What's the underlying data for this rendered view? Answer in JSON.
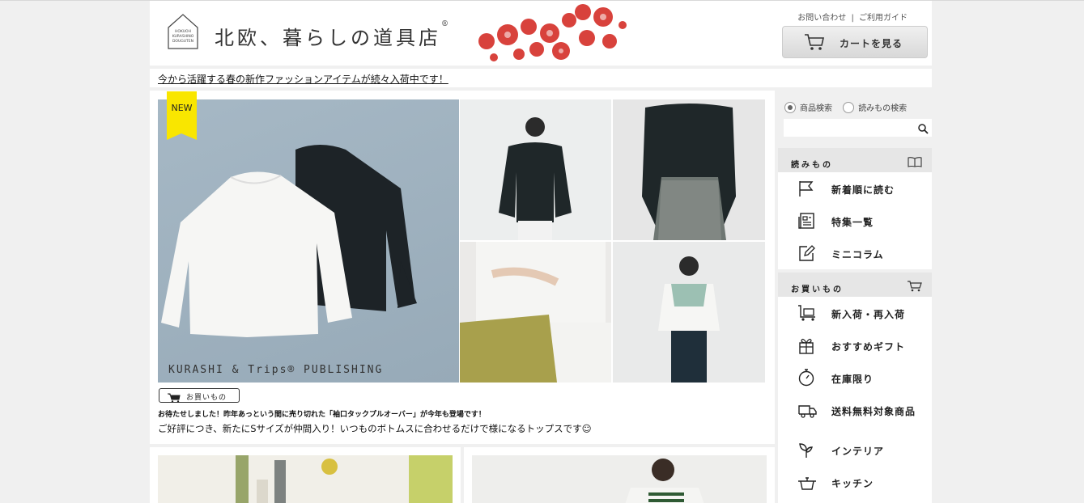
{
  "header": {
    "logo_text": "HOKUOH KURASHINO DOUGUTEN",
    "site_title": "北欧、暮らしの道具店",
    "registered_mark": "®",
    "contact_link": "お問い合わせ",
    "separator": "|",
    "guide_link": "ご利用ガイド",
    "cart_button": "カートを見る"
  },
  "announcement": "今から活躍する春の新作ファッションアイテムが続々入荷中です！",
  "feature": {
    "badge": "NEW",
    "image_caption": "KURASHI & Trips® PUBLISHING",
    "shop_tag": "お買いもの",
    "headline": "お待たせしました！昨年あっという間に売り切れた「袖口タックプルオーバー」が今年も登場です！",
    "description": "ご好評につき、新たにSサイズが仲間入り！いつものボトムスに合わせるだけで様になるトップスです☺"
  },
  "sidebar": {
    "search_options": [
      {
        "label": "商品検索",
        "selected": true
      },
      {
        "label": "読みもの検索",
        "selected": false
      }
    ],
    "search_placeholder": "",
    "sections": [
      {
        "title": "読みもの",
        "icon": "book-icon",
        "items": [
          {
            "label": "新着順に読む",
            "icon": "flag-icon"
          },
          {
            "label": "特集一覧",
            "icon": "newspaper-icon"
          },
          {
            "label": "ミニコラム",
            "icon": "edit-icon"
          }
        ]
      },
      {
        "title": "お買いもの",
        "icon": "cart-icon",
        "items": [
          {
            "label": "新入荷・再入荷",
            "icon": "cart-box-icon"
          },
          {
            "label": "おすすめギフト",
            "icon": "gift-icon"
          },
          {
            "label": "在庫限り",
            "icon": "stopwatch-icon"
          },
          {
            "label": "送料無料対象商品",
            "icon": "truck-icon"
          },
          {
            "label": "インテリア",
            "icon": "plant-icon"
          },
          {
            "label": "キッチン",
            "icon": "pot-icon"
          }
        ]
      }
    ]
  },
  "colors": {
    "badge_yellow": "#f9e600",
    "page_background": "#f0f0f0",
    "section_header": "#e6e6e6",
    "flower_red": "#d8423c"
  }
}
